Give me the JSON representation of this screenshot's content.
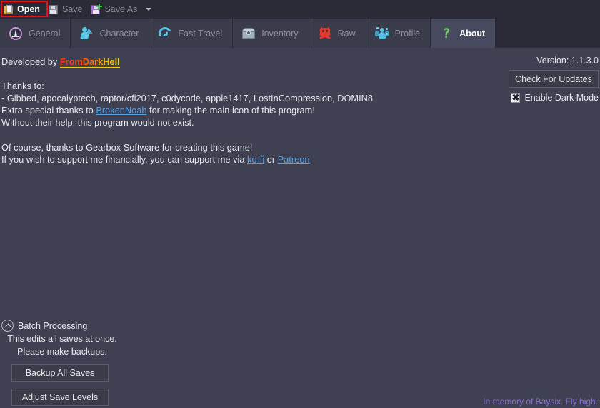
{
  "window": {
    "background_color": "#3f4052",
    "toolbar_color": "#2a2b36"
  },
  "toolbar": {
    "items": [
      {
        "label": "Open",
        "icon": "folder-open-icon",
        "state": "active",
        "highlighted": true
      },
      {
        "label": "Save",
        "icon": "floppy-disk-icon",
        "state": "disabled",
        "highlighted": false
      },
      {
        "label": "Save As",
        "icon": "floppy-disk-plus-icon",
        "state": "disabled",
        "highlighted": false
      }
    ],
    "overflow_icon": "chevron-down-icon",
    "highlight_color": "#ee1111"
  },
  "tabs": [
    {
      "label": "General",
      "icon": "vault-symbol-icon",
      "selected": false
    },
    {
      "label": "Character",
      "icon": "character-bolt-icon",
      "selected": false
    },
    {
      "label": "Fast Travel",
      "icon": "spiral-portal-icon",
      "selected": false
    },
    {
      "label": "Inventory",
      "icon": "treasure-chest-icon",
      "selected": false
    },
    {
      "label": "Raw",
      "icon": "psycho-skull-icon",
      "selected": false
    },
    {
      "label": "Profile",
      "icon": "people-group-icon",
      "selected": false
    },
    {
      "label": "About",
      "icon": "green-question-mark-icon",
      "selected": true
    }
  ],
  "about": {
    "developed_by_prefix": "Developed by ",
    "developer_name": "FromDarkHell",
    "thanks_heading": "Thanks to:",
    "contributors_line": "- Gibbed, apocalyptech, raptor/cfi2017, c0dycode, apple1417, LostInCompression, DOMIN8",
    "special_thanks_prefix": "Extra special thanks to ",
    "special_thanks_name": "BrokenNoah",
    "special_thanks_suffix": " for making the main icon of this program!",
    "without_help_line": "Without their help, this program would not exist.",
    "gearbox_line": "Of course, thanks to Gearbox Software for creating this game!",
    "support_prefix": "If you wish to support me financially, you can support me via ",
    "support_link_1": "ko-fi",
    "support_separator": " or ",
    "support_link_2": "Patreon",
    "link_color": "#5a9fe0"
  },
  "right_panel": {
    "version_label": "Version: 1.1.3.0",
    "check_updates_label": "Check For Updates",
    "dark_mode_label": "Enable Dark Mode",
    "dark_mode_checked": true,
    "dark_mode_check_glyph": "✖"
  },
  "batch": {
    "title": "Batch Processing",
    "expander_icon": "chevron-up-circle-icon",
    "note_line_1": "This edits all saves at once.",
    "note_line_2": "Please make backups.",
    "backup_button": "Backup All Saves",
    "adjust_button": "Adjust Save Levels"
  },
  "footer": {
    "memorial_text": "In memory of Baysix. Fly high.",
    "memorial_color": "#8a6fd4"
  }
}
